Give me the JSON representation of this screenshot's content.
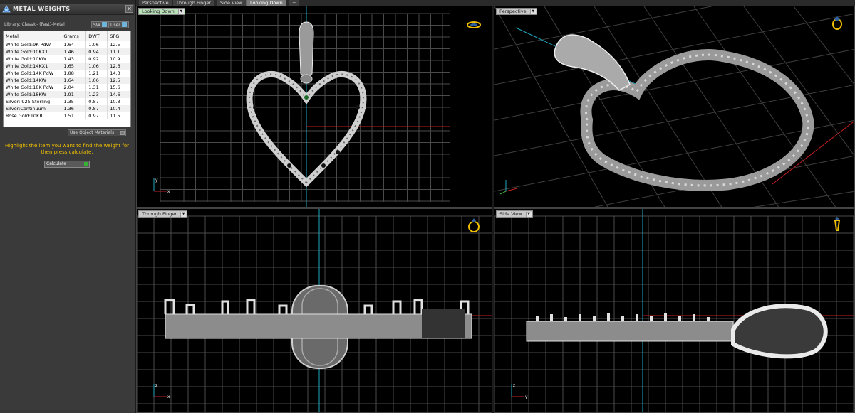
{
  "panel": {
    "title": "METAL WEIGHTS",
    "close": "✕",
    "library": "Library: Classic- (Fast)-Metal",
    "toggle_sw": "SW",
    "toggle_user": "User",
    "columns": [
      "Metal",
      "Grams",
      "DWT",
      "SPG"
    ],
    "rows": [
      [
        "White Gold:9K PdW",
        "1.64",
        "1.06",
        "12.5"
      ],
      [
        "White Gold:10KX1",
        "1.46",
        "0.94",
        "11.1"
      ],
      [
        "White Gold:10KW",
        "1.43",
        "0.92",
        "10.9"
      ],
      [
        "White Gold:14KX1",
        "1.65",
        "1.06",
        "12.6"
      ],
      [
        "White Gold:14K PdW",
        "1.88",
        "1.21",
        "14.3"
      ],
      [
        "White Gold:14KW",
        "1.64",
        "1.06",
        "12.5"
      ],
      [
        "White Gold:18K PdW",
        "2.04",
        "1.31",
        "15.6"
      ],
      [
        "White Gold:18KW",
        "1.91",
        "1.23",
        "14.6"
      ],
      [
        "Silver:.925 Sterling",
        "1.35",
        "0.87",
        "10.3"
      ],
      [
        "Silver:Continuum",
        "1.36",
        "0.87",
        "10.4"
      ],
      [
        "Rose Gold:10KR",
        "1.51",
        "0.97",
        "11.5"
      ]
    ],
    "use_object_materials": "Use Object Materials",
    "instruction": "Highlight the item you want to find the weight for then press calculate.",
    "calculate": "Calculate"
  },
  "tabs": [
    "Perspective",
    "Through Finger",
    "Side View",
    "Looking Down"
  ],
  "active_tab": "Looking Down",
  "viewports": {
    "top_left": {
      "label": "Looking Down"
    },
    "top_right": {
      "label": "Perspective"
    },
    "bottom_left": {
      "label": "Through Finger"
    },
    "bottom_right": {
      "label": "Side View"
    }
  },
  "colors": {
    "grid": "#4a4a4a",
    "axis_red": "#c81e1e",
    "axis_cyan": "#1fa9c0",
    "yellow": "#f0c000",
    "metal_light": "#d8d8d8",
    "metal_dark": "#5a5a5a"
  },
  "icons": {
    "panel_icon": "metal-weights-icon",
    "ring": "ring-orientation-icon",
    "axis": "axis-indicator-icon"
  }
}
